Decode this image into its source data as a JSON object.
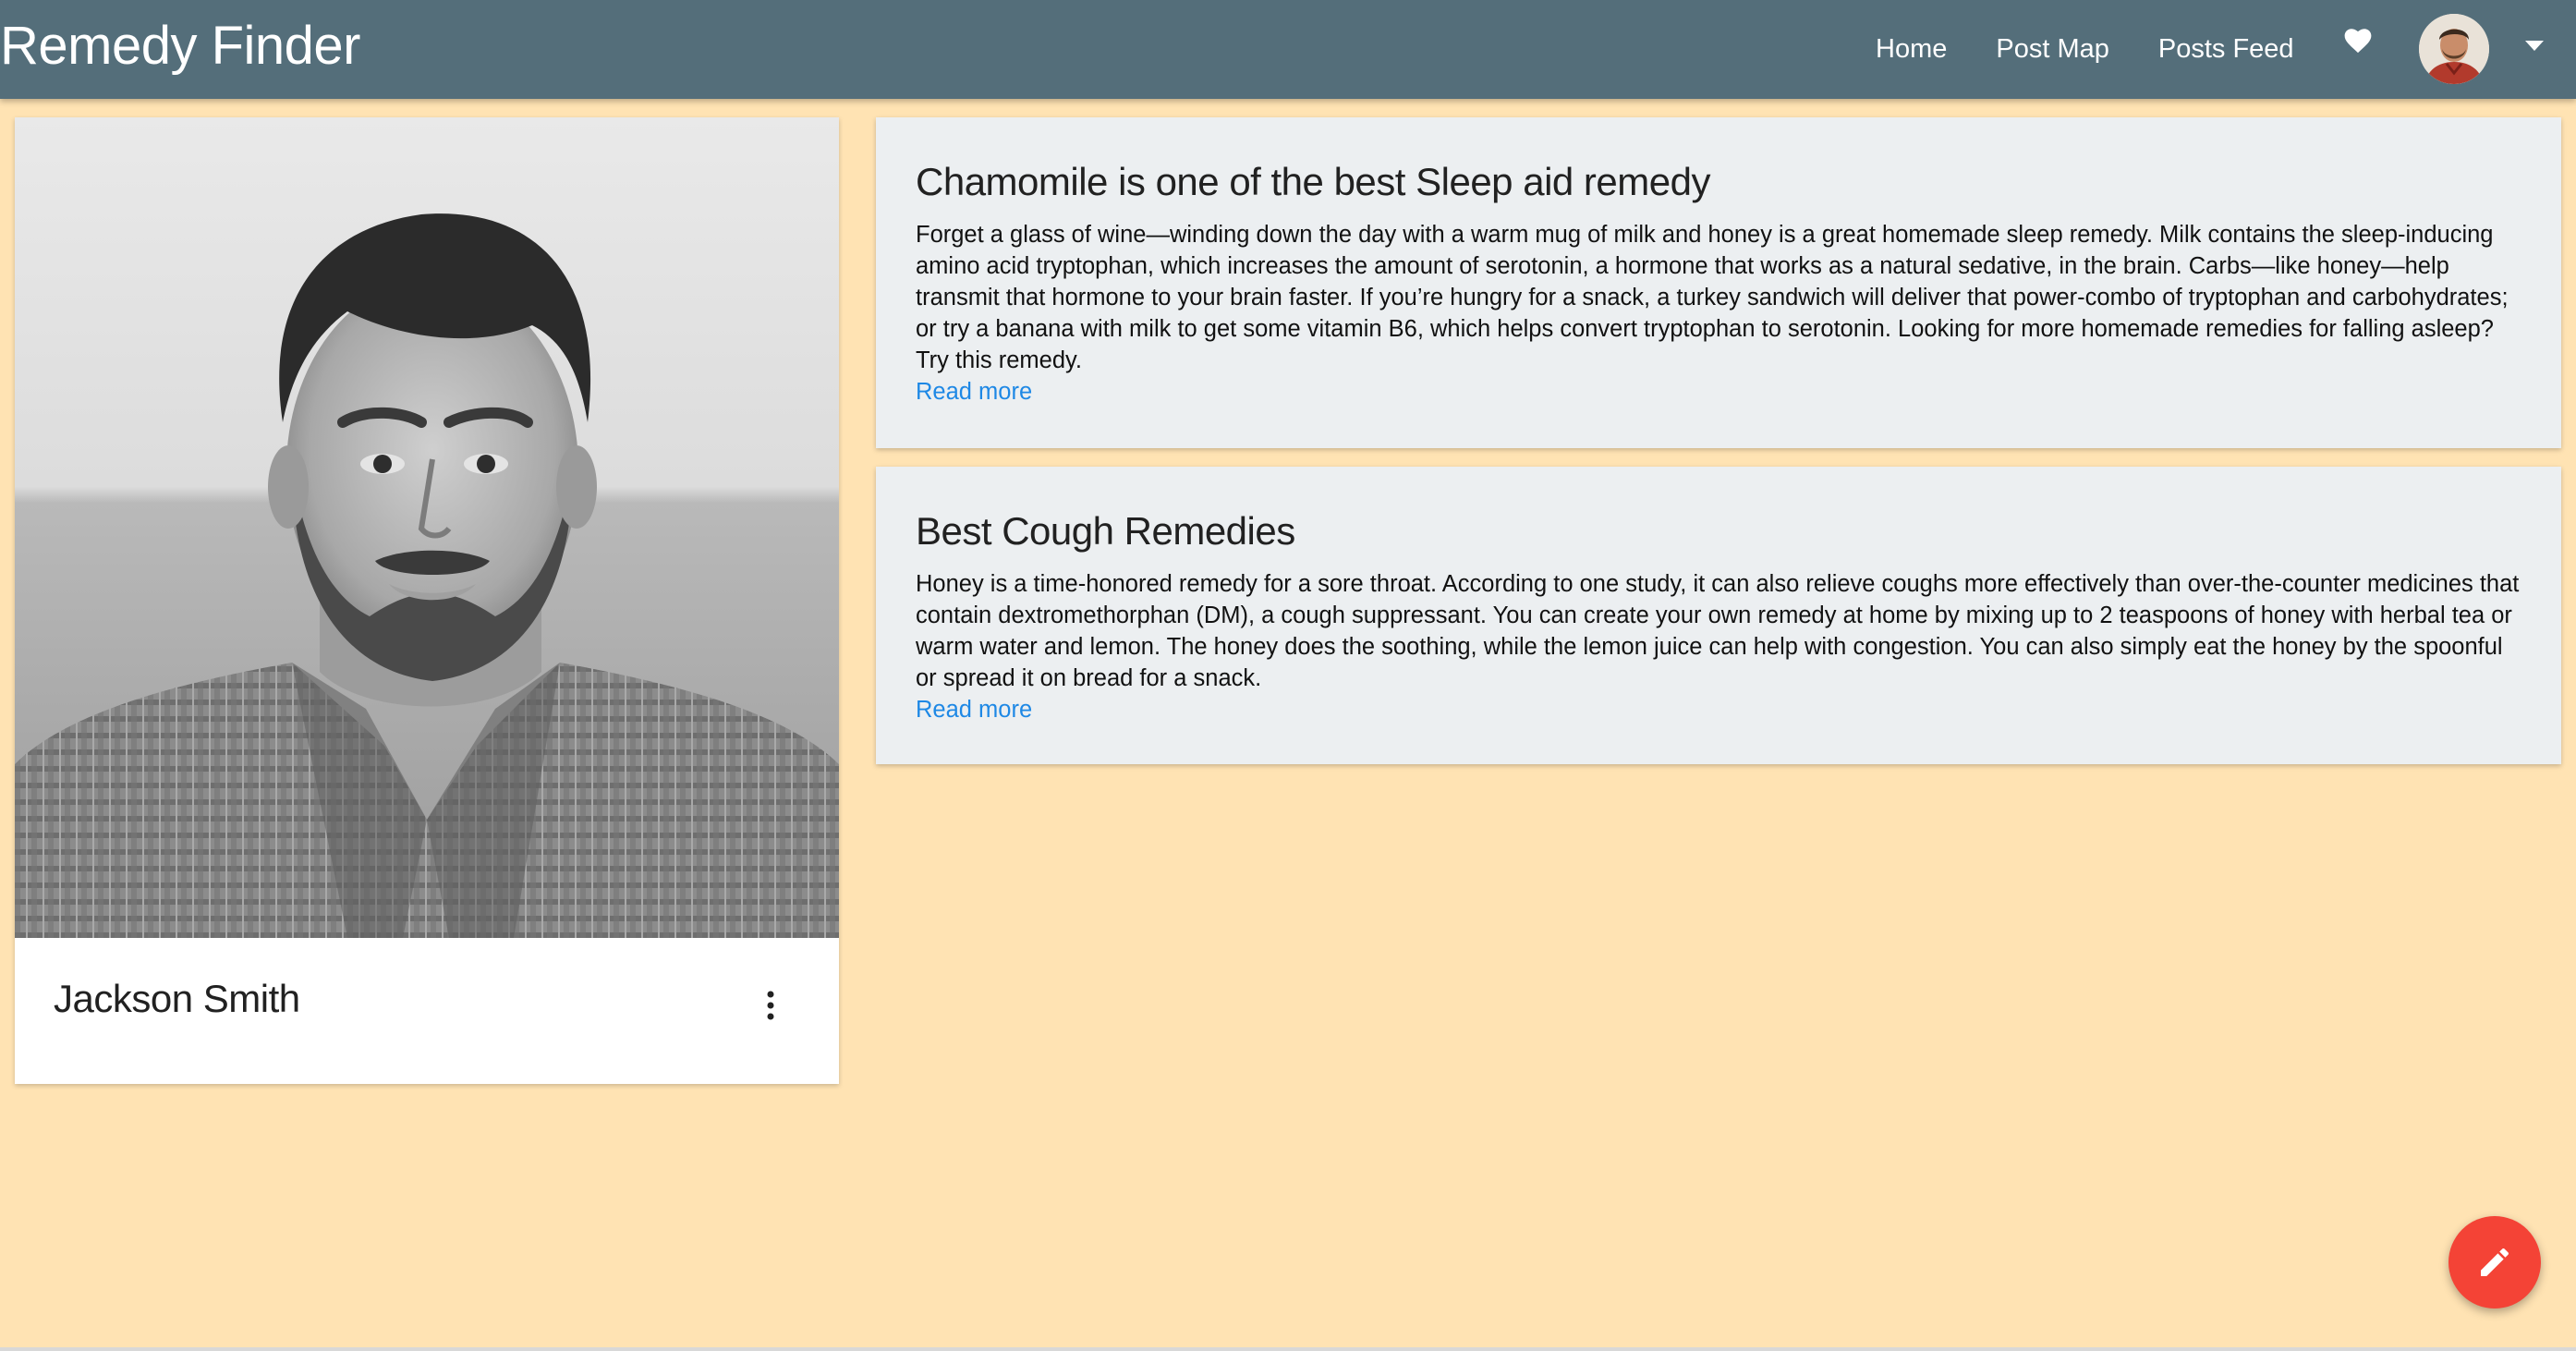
{
  "app": {
    "title": "Remedy Finder"
  },
  "nav": {
    "links": [
      "Home",
      "Post Map",
      "Posts Feed"
    ],
    "favorites_icon": "heart-icon",
    "account_icon": "avatar",
    "dropdown_icon": "caret-down-icon"
  },
  "profile": {
    "name": "Jackson Smith",
    "menu_icon": "more-vert-icon"
  },
  "posts": [
    {
      "title": "Chamomile is one of the best Sleep aid remedy",
      "body": "Forget a glass of wine—winding down the day with a warm mug of milk and honey is a great homemade sleep remedy. Milk contains the sleep-inducing amino acid tryptophan, which increases the amount of serotonin, a hormone that works as a natural sedative, in the brain. Carbs—like honey—help transmit that hormone to your brain faster. If you’re hungry for a snack, a turkey sandwich will deliver that power-combo of tryptophan and carbohydrates; or try a banana with milk to get some vitamin B6, which helps convert tryptophan to serotonin. Looking for more homemade remedies for falling asleep? Try this remedy.",
      "link": "Read more"
    },
    {
      "title": "Best Cough Remedies",
      "body": "Honey is a time-honored remedy for a sore throat. According to one study, it can also relieve coughs more effectively than over-the-counter medicines that contain dextromethorphan (DM), a cough suppressant. You can create your own remedy at home by mixing up to 2 teaspoons of honey with herbal tea or warm water and lemon. The honey does the soothing, while the lemon juice can help with congestion. You can also simply eat the honey by the spoonful or spread it on bread for a snack.",
      "link": "Read more"
    }
  ],
  "fab": {
    "icon": "pencil-icon"
  },
  "colors": {
    "navbar": "#546e7a",
    "background": "#ffe3b3",
    "card": "#eceff1",
    "link": "#1e88e5",
    "fab": "#f44336"
  }
}
